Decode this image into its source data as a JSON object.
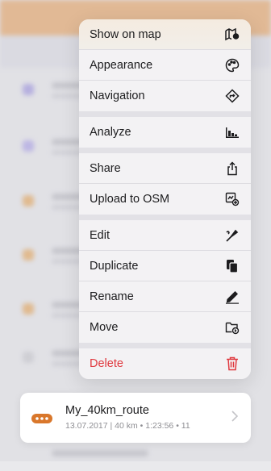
{
  "menu": {
    "items": [
      {
        "label": "Show on map",
        "icon": "map-pin-icon"
      },
      {
        "label": "Appearance",
        "icon": "palette-icon"
      },
      {
        "label": "Navigation",
        "icon": "navigation-diamond-icon"
      },
      {
        "label": "Analyze",
        "icon": "chart-icon"
      },
      {
        "label": "Share",
        "icon": "share-icon"
      },
      {
        "label": "Upload to OSM",
        "icon": "upload-osm-icon"
      },
      {
        "label": "Edit",
        "icon": "edit-icon"
      },
      {
        "label": "Duplicate",
        "icon": "duplicate-icon"
      },
      {
        "label": "Rename",
        "icon": "pencil-icon"
      },
      {
        "label": "Move",
        "icon": "folder-move-icon"
      },
      {
        "label": "Delete",
        "icon": "trash-icon"
      }
    ]
  },
  "track": {
    "name": "My_40km_route",
    "date": "13.07.2017",
    "distance": "40 km",
    "duration": "1:23:56",
    "points": "11"
  },
  "colors": {
    "accent": "#e9a15a",
    "delete": "#e0383e",
    "route_icon": "#d9772b"
  }
}
